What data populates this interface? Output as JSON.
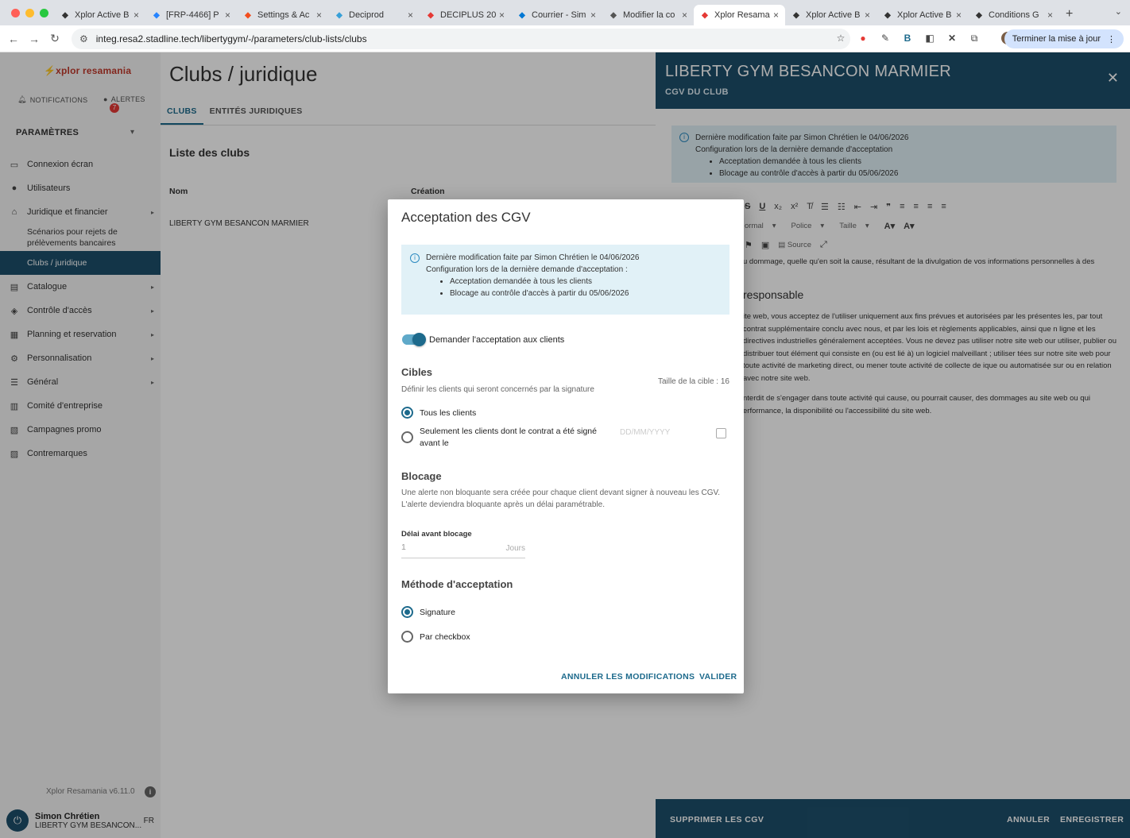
{
  "browser": {
    "tabs": [
      {
        "label": "Xplor Active B",
        "icon": "xplor-icon",
        "color": "#333"
      },
      {
        "label": "[FRP-4466] P",
        "icon": "jira-icon",
        "color": "#2684ff"
      },
      {
        "label": "Settings & Ac",
        "icon": "figma-icon",
        "color": "#f24e1e"
      },
      {
        "label": "Deciprod",
        "icon": "deciprod-icon",
        "color": "#38a0d8"
      },
      {
        "label": "DECIPLUS 20",
        "icon": "rocket-icon",
        "color": "#e53935"
      },
      {
        "label": "Courrier - Sim",
        "icon": "outlook-icon",
        "color": "#0078d4"
      },
      {
        "label": "Modifier la co",
        "icon": "globe-icon",
        "color": "#555"
      },
      {
        "label": "Xplor Resama",
        "icon": "rocket-icon",
        "color": "#e53935"
      },
      {
        "label": "Xplor Active B",
        "icon": "xplor-icon",
        "color": "#333"
      },
      {
        "label": "Xplor Active B",
        "icon": "xplor-icon",
        "color": "#333"
      },
      {
        "label": "Conditions G",
        "icon": "arrow-icon",
        "color": "#333"
      }
    ],
    "active_tab": 7,
    "url": "integ.resa2.stadline.tech/libertygym/-/parameters/club-lists/clubs",
    "update_button": "Terminer la mise à jour"
  },
  "sidebar": {
    "logo": "xplor resamania",
    "notifications": "NOTIFICATIONS",
    "alerts": "ALERTES",
    "alerts_count": "7",
    "section": "PARAMÈTRES",
    "items": [
      {
        "label": "Connexion écran",
        "icon": "screen-icon",
        "caret": false
      },
      {
        "label": "Utilisateurs",
        "icon": "user-icon",
        "caret": false
      },
      {
        "label": "Juridique et financier",
        "icon": "bank-icon",
        "caret": true
      },
      {
        "label": "Scénarios pour rejets de prélèvements bancaires",
        "sub": true
      },
      {
        "label": "Clubs / juridique",
        "sub": true,
        "active": true
      },
      {
        "label": "Catalogue",
        "icon": "catalog-icon",
        "caret": true
      },
      {
        "label": "Contrôle d'accès",
        "icon": "shield-icon",
        "caret": true
      },
      {
        "label": "Planning et reservation",
        "icon": "calendar-icon",
        "caret": true
      },
      {
        "label": "Personnalisation",
        "icon": "gear-icon",
        "caret": true
      },
      {
        "label": "Général",
        "icon": "list-icon",
        "caret": true
      },
      {
        "label": "Comité d'entreprise",
        "icon": "building-icon",
        "caret": false
      },
      {
        "label": "Campagnes promo",
        "icon": "promo-icon",
        "caret": false
      },
      {
        "label": "Contremarques",
        "icon": "ticket-icon",
        "caret": false
      }
    ],
    "version": "Xplor Resamania v6.11.0",
    "user_name": "Simon Chrétien",
    "user_club": "LIBERTY GYM BESANCON...",
    "lang": "FR"
  },
  "main": {
    "title": "Clubs / juridique",
    "tabs": [
      "CLUBS",
      "ENTITÉS JURIDIQUES"
    ],
    "list_title": "Liste des clubs",
    "col_name": "Nom",
    "col_creation": "Création",
    "row": "LIBERTY GYM BESANCON MARMIER"
  },
  "panel": {
    "title": "LIBERTY GYM BESANCON MARMIER",
    "subtitle": "CGV DU CLUB",
    "info_line1": "Dernière modification faite par Simon Chrétien le 04/06/2026",
    "info_line2": "Configuration lors de la dernière demande d'acceptation",
    "info_b1": "Acceptation demandée à tous les clients",
    "info_b2": "Blocage au contrôle d'accès à partir du 05/06/2026",
    "format": "ormal",
    "font": "Police",
    "size": "Taille",
    "source": "Source",
    "p1": "u dommage, quelle qu'en soit la cause, résultant de la divulgation de vos informations personnelles à des",
    "heading": "responsable",
    "p2": "ite web, vous acceptez de l'utiliser uniquement aux fins prévues et autorisées par les présentes les, par tout contrat supplémentaire conclu avec nous, et par les lois et règlements applicables, ainsi que n ligne et les directives industrielles généralement acceptées. Vous ne devez pas utiliser notre site web our utiliser, publier ou distribuer tout élément qui consiste en (ou est lié à) un logiciel malveillant ; utiliser tées sur notre site web pour toute activité de marketing direct, ou mener toute activité de collecte de ique ou automatisée sur ou en relation avec notre site web.",
    "p3": "nterdit de s'engager dans toute activité qui cause, ou pourrait causer, des dommages au site web ou qui erformance, la disponibilité ou l'accessibilité du site web.",
    "delete": "SUPPRIMER LES CGV",
    "cancel": "ANNULER",
    "save": "ENREGISTRER"
  },
  "dialog": {
    "title": "Acceptation des CGV",
    "info_line1": "Dernière modification faite par Simon Chrétien le 04/06/2026",
    "info_line2": "Configuration lors de la dernière demande d'acceptation :",
    "info_b1": "Acceptation demandée à tous les clients",
    "info_b2": "Blocage au contrôle d'accès à partir du 05/06/2026",
    "toggle_label": "Demander l'acceptation aux clients",
    "toggle_on": true,
    "targets_title": "Cibles",
    "targets_desc": "Définir les clients qui seront concernés par la signature",
    "target_size": "Taille de la cible : 16",
    "opt_all": "Tous les clients",
    "opt_before": "Seulement les clients dont le contrat a été signé avant le",
    "date_placeholder": "DD/MM/YYYY",
    "block_title": "Blocage",
    "block_desc1": "Une alerte non bloquante sera créée pour chaque client devant signer à nouveau les CGV.",
    "block_desc2": "L'alerte deviendra bloquante après un délai paramétrable.",
    "delay_label": "Délai avant blocage",
    "delay_value": "1",
    "delay_unit": "Jours",
    "method_title": "Méthode d'acceptation",
    "method_signature": "Signature",
    "method_checkbox": "Par checkbox",
    "btn_cancel": "ANNULER LES MODIFICATIONS",
    "btn_ok": "VALIDER"
  }
}
